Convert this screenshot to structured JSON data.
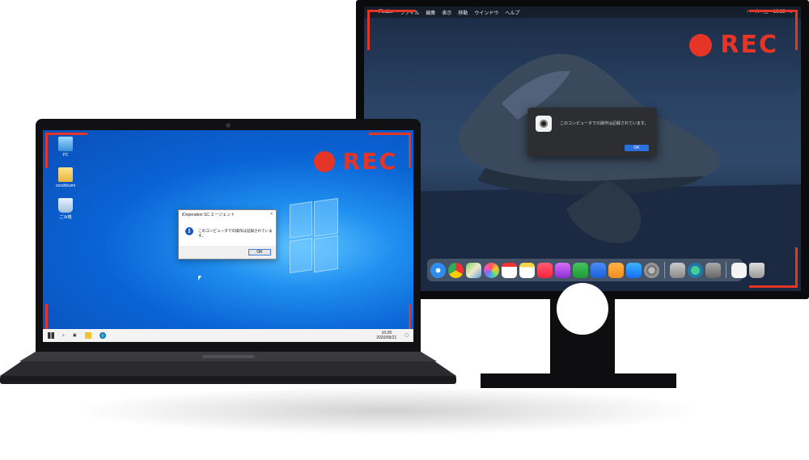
{
  "monitor": {
    "menubar": {
      "apple": "",
      "items": [
        "Finder",
        "ファイル",
        "編集",
        "表示",
        "移動",
        "ウインドウ",
        "ヘルプ"
      ],
      "clock": "16:28"
    },
    "rec_label": "REC",
    "dialog": {
      "message": "このコンピュータでの操作は記録されています。",
      "ok_label": "OK"
    }
  },
  "laptop": {
    "rec_label": "REC",
    "desktop_icons": [
      "PC",
      "ocrshikumi",
      "ごみ箱"
    ],
    "dialog": {
      "title": "iDoperation SC エージェント",
      "close": "×",
      "info_glyph": "i",
      "message": "このコンピュータでの操作は記録されています。",
      "ok_label": "OK"
    },
    "taskbar": {
      "time": "16:28",
      "date": "2020/09/21"
    }
  },
  "colors": {
    "rec_red": "#e53527",
    "mac_ok_blue": "#2c6fe0",
    "win_info_blue": "#1a56c4"
  }
}
